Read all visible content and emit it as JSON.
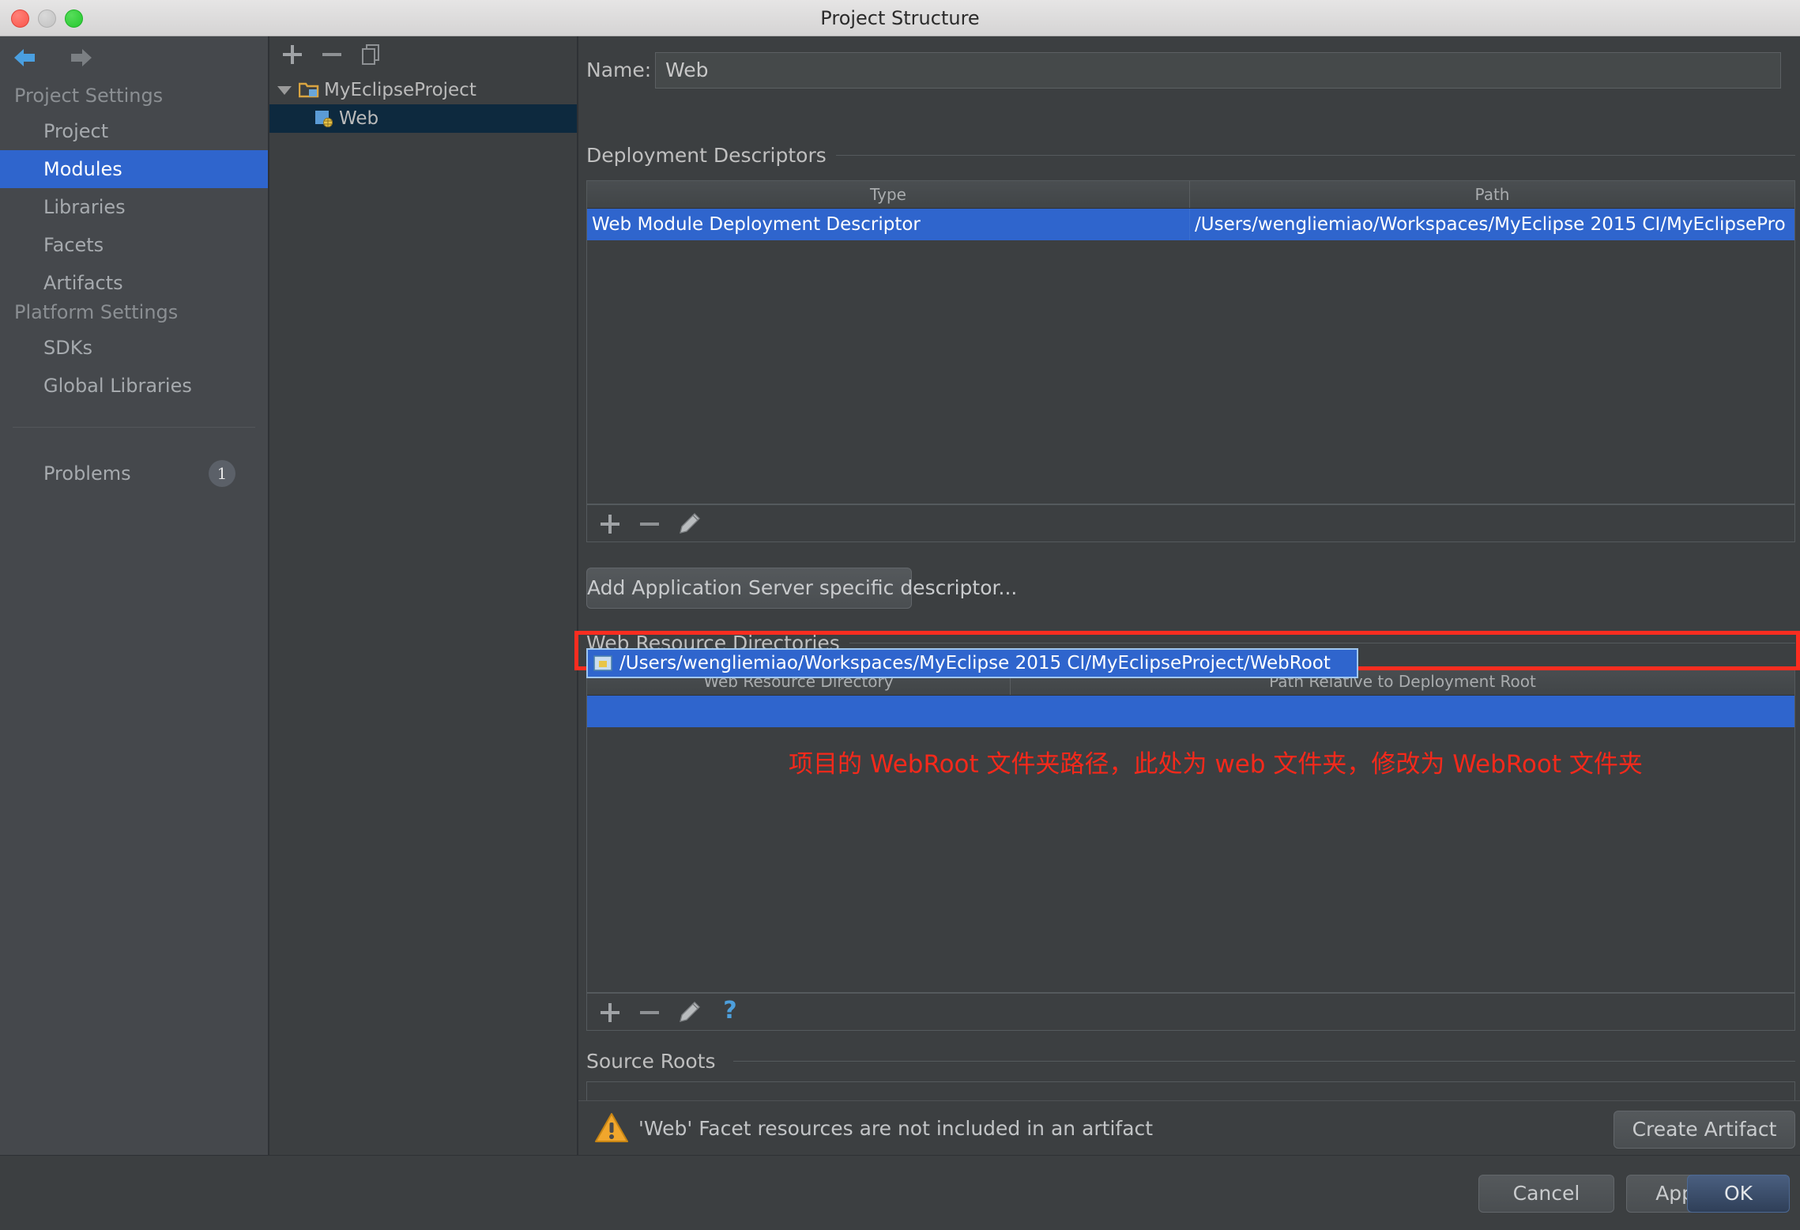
{
  "window": {
    "title": "Project Structure",
    "traffic_lights": [
      "close-button",
      "minimize-button",
      "zoom-button"
    ]
  },
  "sidebar": {
    "nav": {
      "back": "back-arrow",
      "forward": "forward-arrow"
    },
    "groups": [
      {
        "header": "Project Settings",
        "items": [
          {
            "label": "Project",
            "selected": false
          },
          {
            "label": "Modules",
            "selected": true
          },
          {
            "label": "Libraries",
            "selected": false
          },
          {
            "label": "Facets",
            "selected": false
          },
          {
            "label": "Artifacts",
            "selected": false
          }
        ]
      },
      {
        "header": "Platform Settings",
        "items": [
          {
            "label": "SDKs",
            "selected": false
          },
          {
            "label": "Global Libraries",
            "selected": false
          }
        ]
      }
    ],
    "problems": {
      "label": "Problems",
      "count": "1"
    },
    "help_icon": "?"
  },
  "tree": {
    "toolbar": [
      {
        "name": "add-module-button",
        "glyph": "+"
      },
      {
        "name": "remove-module-button",
        "glyph": "−"
      },
      {
        "name": "copy-module-button",
        "glyph": "copy"
      }
    ],
    "nodes": [
      {
        "label": "MyEclipseProject",
        "icon": "project-folder-icon",
        "selected": false,
        "expanded": true,
        "depth": 0
      },
      {
        "label": "Web",
        "icon": "web-facet-icon",
        "selected": true,
        "expanded": false,
        "depth": 1
      }
    ]
  },
  "main": {
    "name_field": {
      "label": "Name:",
      "value": "Web"
    },
    "deployment_descriptors": {
      "title": "Deployment Descriptors",
      "columns": [
        "Type",
        "Path"
      ],
      "rows": [
        {
          "type": "Web Module Deployment Descriptor",
          "path": "/Users/wengliemiao/Workspaces/MyEclipse 2015 CI/MyEclipsePro",
          "selected": true
        }
      ],
      "toolbar": [
        {
          "name": "add-descriptor-button",
          "glyph": "+"
        },
        {
          "name": "remove-descriptor-button",
          "glyph": "−"
        },
        {
          "name": "edit-descriptor-button",
          "glyph": "pencil"
        }
      ],
      "add_server_descriptor_button": "Add Application Server specific descriptor..."
    },
    "web_resource_directories": {
      "title": "Web Resource Directories",
      "columns": [
        "Web Resource Directory",
        "Path Relative to Deployment Root"
      ],
      "rows": [
        {
          "directory": "/Users/wengliemiao/Workspaces/MyEclipse 2015 CI/MyEclipseProject/WebRoot",
          "relative_path": "",
          "selected": true,
          "editing": true
        }
      ],
      "toolbar": [
        {
          "name": "add-web-resource-button",
          "glyph": "+"
        },
        {
          "name": "remove-web-resource-button",
          "glyph": "−"
        },
        {
          "name": "edit-web-resource-button",
          "glyph": "pencil"
        },
        {
          "name": "web-resource-help-button",
          "glyph": "?"
        }
      ]
    },
    "source_roots": {
      "title": "Source Roots"
    },
    "warning": {
      "icon": "warning-triangle-icon",
      "text": "'Web' Facet resources are not included in an artifact",
      "action_button": "Create Artifact"
    },
    "annotation": "项目的 WebRoot 文件夹路径，此处为 web 文件夹，修改为 WebRoot 文件夹"
  },
  "footer": {
    "buttons": [
      {
        "label": "Cancel",
        "primary": false
      },
      {
        "label": "Apply",
        "primary": false
      },
      {
        "label": "OK",
        "primary": true
      }
    ]
  },
  "colors": {
    "accent_blue": "#2f65cd",
    "selection_tree": "#0d293e",
    "annotation_red": "#f5291b",
    "background": "#3c3f41",
    "sidebar_bg": "#45484c",
    "warning_amber": "#f0a62c"
  }
}
